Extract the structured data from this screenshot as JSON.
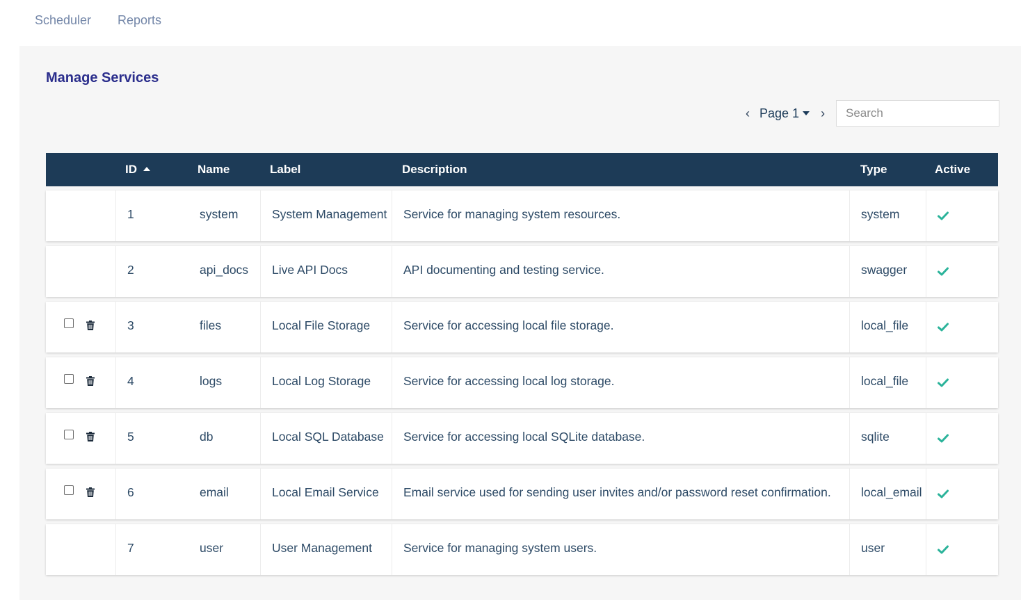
{
  "nav": {
    "tabs": [
      {
        "label": "Scheduler"
      },
      {
        "label": "Reports"
      }
    ]
  },
  "page": {
    "title": "Manage Services"
  },
  "pager": {
    "label": "Page 1"
  },
  "search": {
    "placeholder": "Search",
    "value": ""
  },
  "table": {
    "columns": {
      "id": "ID",
      "name": "Name",
      "label": "Label",
      "description": "Description",
      "type": "Type",
      "active": "Active"
    },
    "sort": {
      "column": "ID",
      "direction": "ascending"
    },
    "rows": [
      {
        "id": "1",
        "name": "system",
        "label": "System Management",
        "description": "Service for managing system resources.",
        "type": "system",
        "active": true,
        "deletable": false
      },
      {
        "id": "2",
        "name": "api_docs",
        "label": "Live API Docs",
        "description": "API documenting and testing service.",
        "type": "swagger",
        "active": true,
        "deletable": false
      },
      {
        "id": "3",
        "name": "files",
        "label": "Local File Storage",
        "description": "Service for accessing local file storage.",
        "type": "local_file",
        "active": true,
        "deletable": true
      },
      {
        "id": "4",
        "name": "logs",
        "label": "Local Log Storage",
        "description": "Service for accessing local log storage.",
        "type": "local_file",
        "active": true,
        "deletable": true
      },
      {
        "id": "5",
        "name": "db",
        "label": "Local SQL Database",
        "description": "Service for accessing local SQLite database.",
        "type": "sqlite",
        "active": true,
        "deletable": true
      },
      {
        "id": "6",
        "name": "email",
        "label": "Local Email Service",
        "description": "Email service used for sending user invites and/or password reset confirmation.",
        "type": "local_email",
        "active": true,
        "deletable": true
      },
      {
        "id": "7",
        "name": "user",
        "label": "User Management",
        "description": "Service for managing system users.",
        "type": "user",
        "active": true,
        "deletable": false
      }
    ]
  },
  "colors": {
    "header_bg": "#1d3b57",
    "title": "#2b2e8c",
    "nav_text": "#7386a8",
    "check": "#2bb39a",
    "cell_text": "#2d4a66"
  },
  "icons": {
    "prev": "chevron-left-icon",
    "next": "chevron-right-icon",
    "delete": "trash-icon",
    "active": "checkmark-icon",
    "sort": "sort-ascending-icon"
  }
}
